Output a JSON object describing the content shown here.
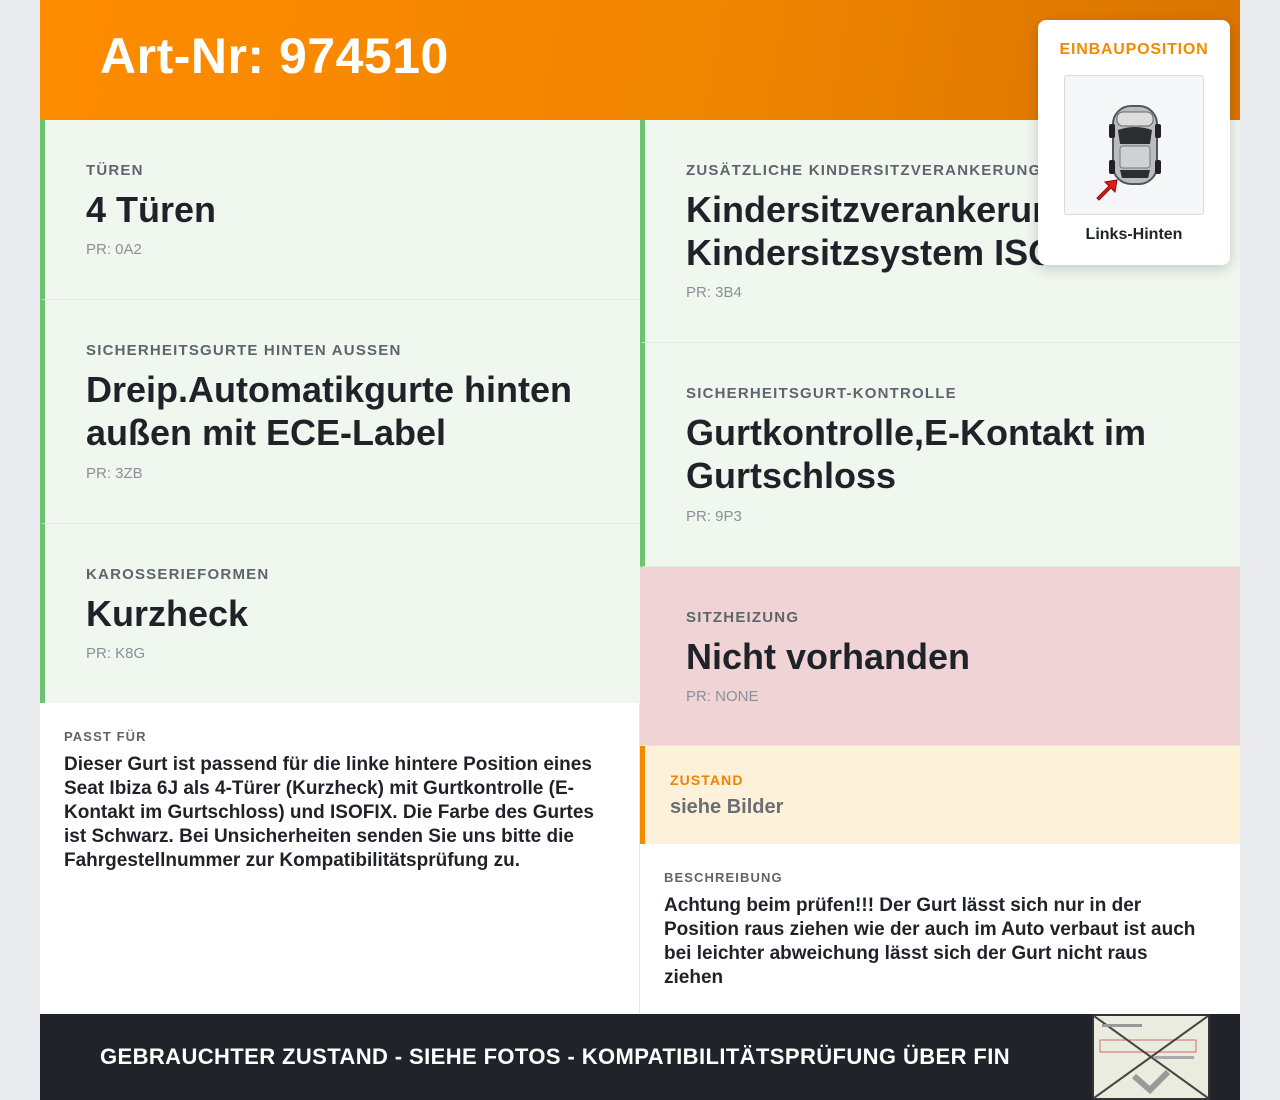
{
  "header": {
    "title": "Art-Nr: 974510"
  },
  "features": [
    {
      "label": "Türen",
      "value": "4 Türen",
      "pr": "PR: 0A2",
      "status": "ok"
    },
    {
      "label": "Zusätzliche Kindersitzverankerung",
      "value": "Kindersitzverankerung Kindersitzsystem ISOFIX",
      "pr": "PR: 3B4",
      "status": "ok"
    },
    {
      "label": "Sicherheitsgurte hinten aussen",
      "value": "Dreip.Automatikgurte hinten außen mit ECE-Label",
      "pr": "PR: 3ZB",
      "status": "ok"
    },
    {
      "label": "Sicherheitsgurt-Kontrolle",
      "value": "Gurtkontrolle,E-Kontakt im Gurtschloss",
      "pr": "PR: 9P3",
      "status": "ok"
    },
    {
      "label": "Karosserieformen",
      "value": "Kurzheck",
      "pr": "PR: K8G",
      "status": "ok"
    },
    {
      "label": "Sitzheizung",
      "value": "Nicht vorhanden",
      "pr": "PR: NONE",
      "status": "missing"
    }
  ],
  "passt_fuer": {
    "label": "Passt für",
    "text": "Dieser Gurt ist passend für die linke hintere Position eines Seat Ibiza 6J als 4-Türer (Kurzheck) mit Gurtkontrolle (E-Kontakt im Gurtschloss) und ISOFIX. Die Farbe des Gurtes ist Schwarz. Bei Unsicherheiten senden Sie uns bitte die Fahrgestellnummer zur Kompatibilitätsprüfung zu."
  },
  "zustand": {
    "label": "Zustand",
    "value": "siehe Bilder"
  },
  "beschreibung": {
    "label": "Beschreibung",
    "text": "Achtung beim prüfen!!! Der Gurt lässt sich nur in der Position raus ziehen wie der auch im Auto verbaut ist auch bei leichter abweichung lässt sich der Gurt nicht raus ziehen"
  },
  "einbauposition": {
    "title": "EINBAUPOSITION",
    "caption": "Links-Hinten",
    "icon": "car-top-view-icon"
  },
  "footer": {
    "text": "GEBRAUCHTER ZUSTAND - SIEHE FOTOS - KOMPATIBILITÄTSPRÜFUNG ÜBER FIN"
  },
  "colors": {
    "accent": "#ff8c00",
    "ok": "#6cc471",
    "ok_bg": "#f0f7ef",
    "missing_bg": "#f0d4d5",
    "footer_bg": "#202329"
  }
}
